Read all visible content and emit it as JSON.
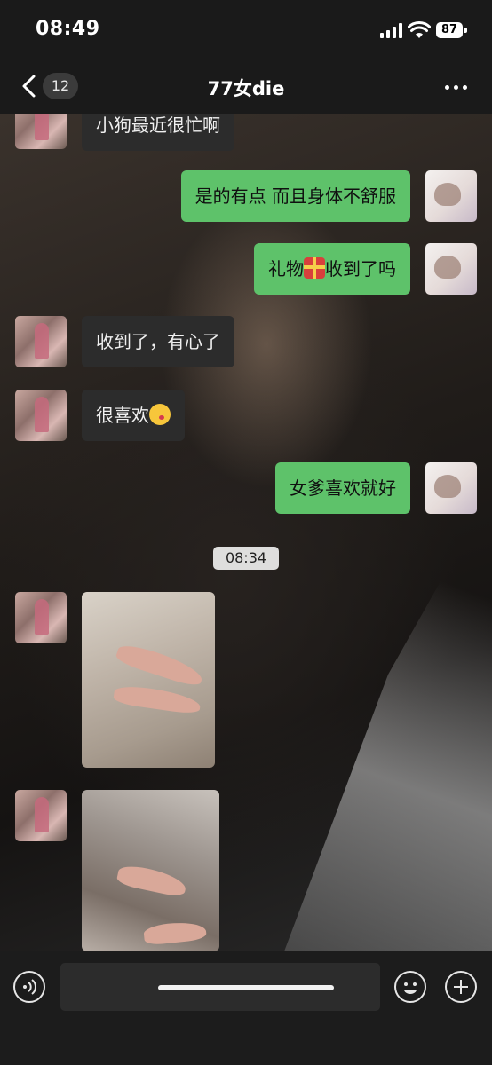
{
  "status_bar": {
    "time": "08:49",
    "battery": "87"
  },
  "nav": {
    "unread_count": "12",
    "title": "77女die"
  },
  "messages": [
    {
      "side": "left",
      "text": "小狗最近很忙啊"
    },
    {
      "side": "right",
      "text": "是的有点 而且身体不舒服"
    },
    {
      "side": "right",
      "text_before": "礼物",
      "emoji": "gift-emoji",
      "text_after": "收到了吗"
    },
    {
      "side": "left",
      "text": "收到了，有心了"
    },
    {
      "side": "left",
      "text": "很喜欢",
      "emoji": "kissing-face-emoji"
    },
    {
      "side": "right",
      "text": "女爹喜欢就好"
    }
  ],
  "timestamp": "08:34",
  "photos": [
    {
      "description_icon": "shoe-photo",
      "side": "left"
    },
    {
      "description_icon": "shoe-photo",
      "side": "left"
    }
  ],
  "colors": {
    "outgoing_bubble": "#5ec26a",
    "incoming_bubble": "#2c2c2c",
    "bar_bg": "#1a1a1a"
  }
}
